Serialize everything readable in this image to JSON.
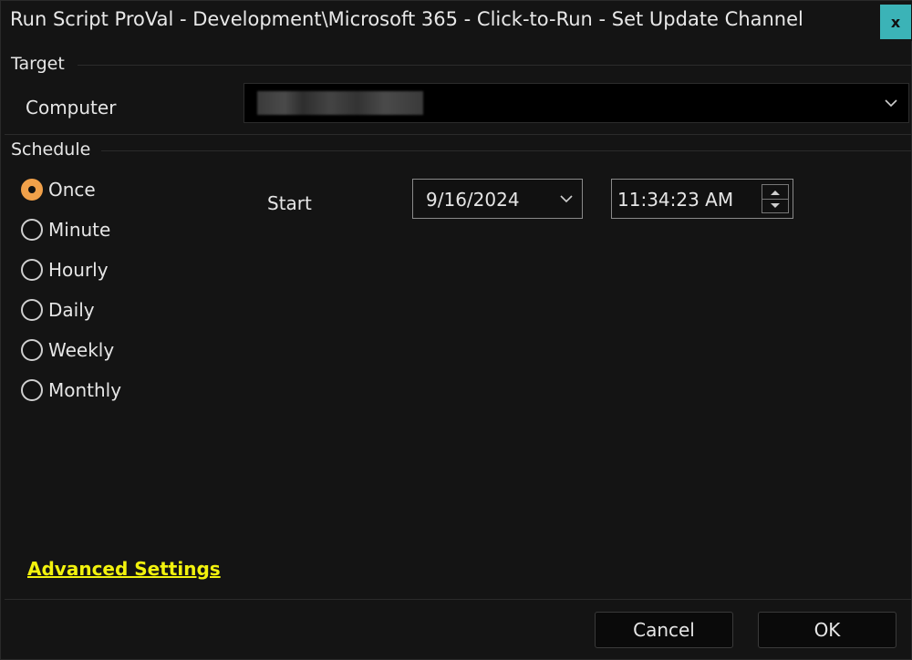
{
  "window": {
    "title": "Run Script ProVal - Development\\Microsoft 365 - Click-to-Run - Set Update Channel",
    "close_label": "x"
  },
  "target": {
    "section_label": "Target",
    "computer_label": "Computer",
    "computer_value": ""
  },
  "schedule": {
    "section_label": "Schedule",
    "options": [
      {
        "label": "Once",
        "checked": true
      },
      {
        "label": "Minute",
        "checked": false
      },
      {
        "label": "Hourly",
        "checked": false
      },
      {
        "label": "Daily",
        "checked": false
      },
      {
        "label": "Weekly",
        "checked": false
      },
      {
        "label": "Monthly",
        "checked": false
      }
    ],
    "start_label": "Start",
    "start_date": "9/16/2024",
    "start_time": "11:34:23 AM"
  },
  "advanced_settings_label": "Advanced Settings",
  "buttons": {
    "cancel_label": "Cancel",
    "ok_label": "OK"
  },
  "colors": {
    "accent_close": "#3bb3b7",
    "radio_checked": "#f1a14a",
    "link": "#f2f20d",
    "background": "#141414"
  },
  "icons": {
    "dropdown": "chevron-down-icon",
    "spin_up": "arrow-up-icon",
    "spin_down": "arrow-down-icon"
  }
}
